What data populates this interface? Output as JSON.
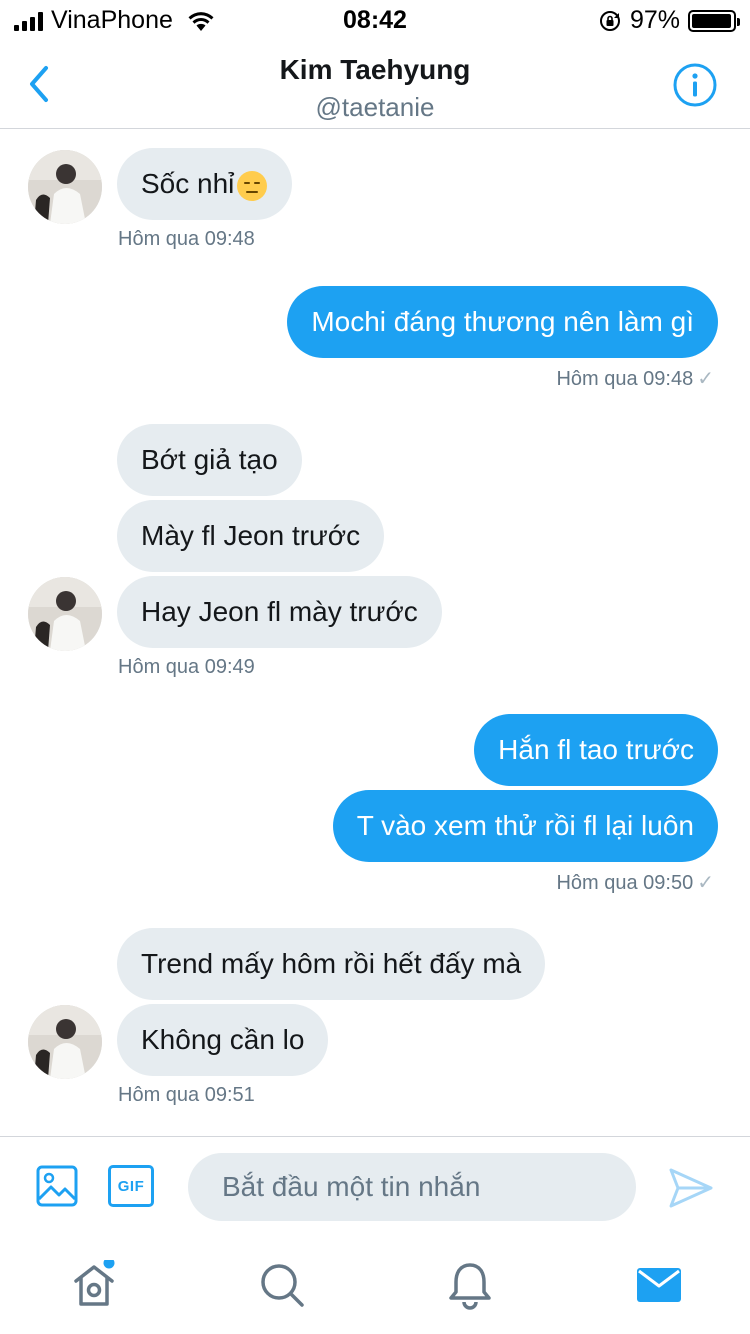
{
  "status_bar": {
    "carrier": "VinaPhone",
    "time": "08:42",
    "battery": "97%",
    "battery_level": 0.97
  },
  "header": {
    "name": "Kim Taehyung",
    "handle": "@taetanie"
  },
  "messages": [
    {
      "direction": "in",
      "text": "Sốc nhỉ",
      "emoji": "expressionless-face"
    },
    {
      "direction": "in",
      "meta": "Hôm qua 09:48"
    },
    {
      "direction": "out",
      "text": "Mochi đáng thương nên làm gì"
    },
    {
      "direction": "out",
      "meta": "Hôm qua 09:48"
    },
    {
      "direction": "in",
      "text": "Bớt giả tạo"
    },
    {
      "direction": "in",
      "text": "Mày fl Jeon trước"
    },
    {
      "direction": "in",
      "text": "Hay Jeon fl mày trước"
    },
    {
      "direction": "in",
      "meta": "Hôm qua 09:49"
    },
    {
      "direction": "out",
      "text": "Hắn fl tao trước"
    },
    {
      "direction": "out",
      "text": "T vào xem thử rồi fl lại luôn"
    },
    {
      "direction": "out",
      "meta": "Hôm qua 09:50"
    },
    {
      "direction": "in",
      "text": "Trend mấy hôm rồi hết đấy mà"
    },
    {
      "direction": "in",
      "text": "Không cần lo"
    },
    {
      "direction": "in",
      "meta": "Hôm qua 09:51"
    }
  ],
  "composer": {
    "placeholder": "Bắt đầu một tin nhắn",
    "gif_label": "GIF"
  },
  "tabbar": {
    "items": [
      "home-icon",
      "search-icon",
      "notifications-icon",
      "messages-icon"
    ],
    "active": "messages-icon"
  },
  "colors": {
    "accent": "#1da1f2",
    "incoming_bubble": "#e6ecf0",
    "meta_text": "#657786"
  }
}
